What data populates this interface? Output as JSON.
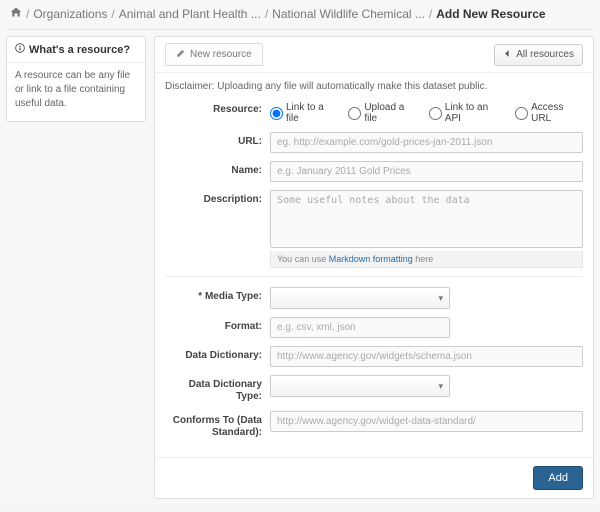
{
  "breadcrumb": {
    "items": [
      "Organizations",
      "Animal and Plant Health ...",
      "National Wildlife Chemical ..."
    ],
    "current": "Add New Resource"
  },
  "sidebar": {
    "title": "What's a resource?",
    "body": "A resource can be any file or link to a file containing useful data."
  },
  "tab_label": "New resource",
  "all_resources_label": "All resources",
  "disclaimer": "Disclaimer: Uploading any file will automatically make this dataset public.",
  "labels": {
    "resource": "Resource:",
    "url": "URL:",
    "name": "Name:",
    "description": "Description:",
    "media_type": "* Media Type:",
    "format": "Format:",
    "data_dictionary": "Data Dictionary:",
    "data_dictionary_type": "Data Dictionary Type:",
    "conforms_to": "Conforms To (Data Standard):"
  },
  "resource_options": {
    "link_file": "Link to a file",
    "upload_file": "Upload a file",
    "link_api": "Link to an API",
    "access_url": "Access URL"
  },
  "placeholders": {
    "url": "eg. http://example.com/gold-prices-jan-2011.json",
    "name": "e.g. January 2011 Gold Prices",
    "description": "Some useful notes about the data",
    "format": "e.g. csv, xml, json",
    "data_dictionary": "http://www.agency.gov/widgets/schema.json",
    "conforms_to": "http://www.agency.gov/widget-data-standard/"
  },
  "description_hint_prefix": "You can use ",
  "description_hint_link": "Markdown formatting",
  "description_hint_suffix": " here",
  "add_button": "Add"
}
